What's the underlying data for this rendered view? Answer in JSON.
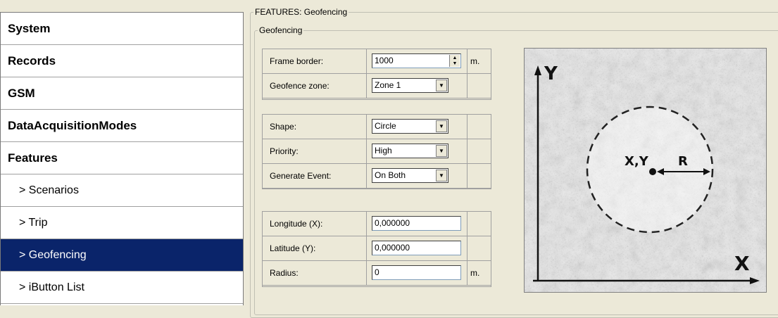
{
  "sidebar": {
    "items": [
      {
        "label": "System"
      },
      {
        "label": "Records"
      },
      {
        "label": "GSM"
      },
      {
        "label": "DataAcquisitionModes"
      },
      {
        "label": "Features"
      },
      {
        "label": "> Scenarios"
      },
      {
        "label": "> Trip"
      },
      {
        "label": "> Geofencing"
      },
      {
        "label": "> iButton List"
      }
    ]
  },
  "panel": {
    "outer_legend": "FEATURES: Geofencing",
    "inner_legend": "Geofencing",
    "frame_border": {
      "label": "Frame border:",
      "value": "1000",
      "unit": "m."
    },
    "geofence_zone": {
      "label": "Geofence zone:",
      "value": "Zone 1"
    },
    "shape": {
      "label": "Shape:",
      "value": "Circle"
    },
    "priority": {
      "label": "Priority:",
      "value": "High"
    },
    "generate_event": {
      "label": "Generate Event:",
      "value": "On Both"
    },
    "longitude": {
      "label": "Longitude (X):",
      "value": "0,000000"
    },
    "latitude": {
      "label": "Latitude (Y):",
      "value": "0,000000"
    },
    "radius": {
      "label": "Radius:",
      "value": "0",
      "unit": "m."
    }
  },
  "map": {
    "y_axis": "Y",
    "x_axis": "X",
    "center_label": "X,Y",
    "radius_label": "R"
  },
  "colors": {
    "active_item": "#0a246a",
    "panel_bg": "#ece9d8"
  }
}
